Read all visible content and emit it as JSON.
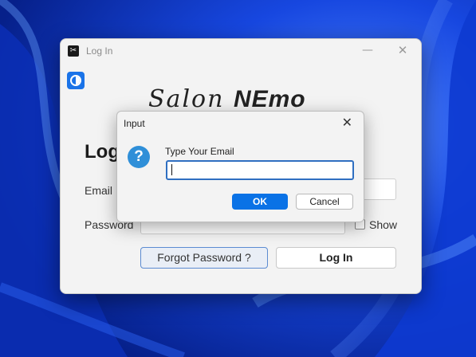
{
  "login_window": {
    "title": "Log In",
    "minimize_glyph": "—",
    "close_glyph": "✕",
    "logo": {
      "part1": "Salon ",
      "part2": "NEmo"
    },
    "heading": "Log",
    "email_label": "Email",
    "email_value": "",
    "password_label": "Password",
    "password_value": "",
    "show_label": "Show",
    "show_checked": false,
    "forgot_button": "Forgot Password ?",
    "login_button": "Log In"
  },
  "input_dialog": {
    "title": "Input",
    "close_glyph": "✕",
    "icon_glyph": "?",
    "prompt": "Type Your Email",
    "input_value": "",
    "ok_label": "OK",
    "cancel_label": "Cancel"
  },
  "colors": {
    "accent": "#0a72e6",
    "wallpaper": "#0a3fd6",
    "window_bg": "#f3f3f3"
  }
}
